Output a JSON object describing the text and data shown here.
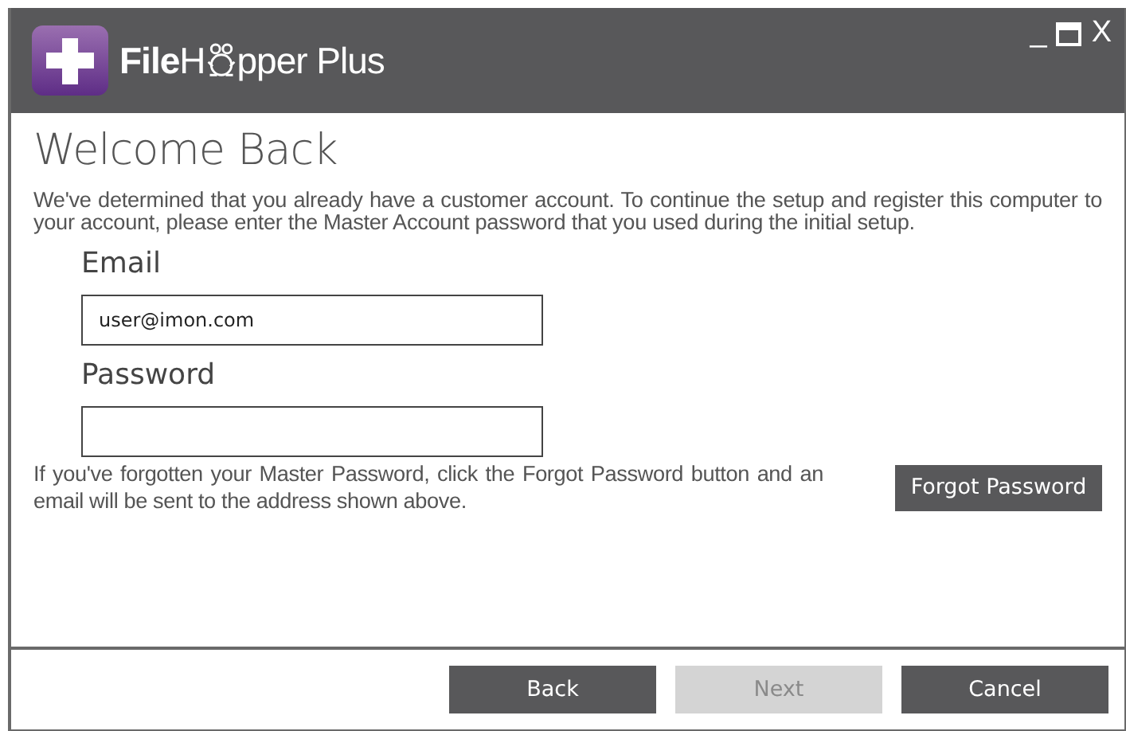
{
  "logo": {
    "before_icon": "**File**H",
    "after_icon": "pper Plus"
  },
  "window_controls": [
    "_",
    "X"
  ],
  "heading": "Welcome Back",
  "intro": "We've determined that you already have a customer account. To continue the setup and register this computer to your account, please enter the Master Account password that you used during the initial setup.",
  "fields": [
    {
      "label": "Email",
      "value": "user@imon.com"
    },
    {
      "label": "Password"
    }
  ],
  "forgot": {
    "text": "If you've forgotten your Master Password, click the Forgot Password button and an email will be sent to the address shown above.",
    "button": "Forgot Password"
  },
  "buttons": [
    {
      "label": "Back",
      "disabled": false
    },
    {
      "label": "Next",
      "disabled": true
    },
    {
      "label": "Cancel",
      "disabled": false
    }
  ]
}
